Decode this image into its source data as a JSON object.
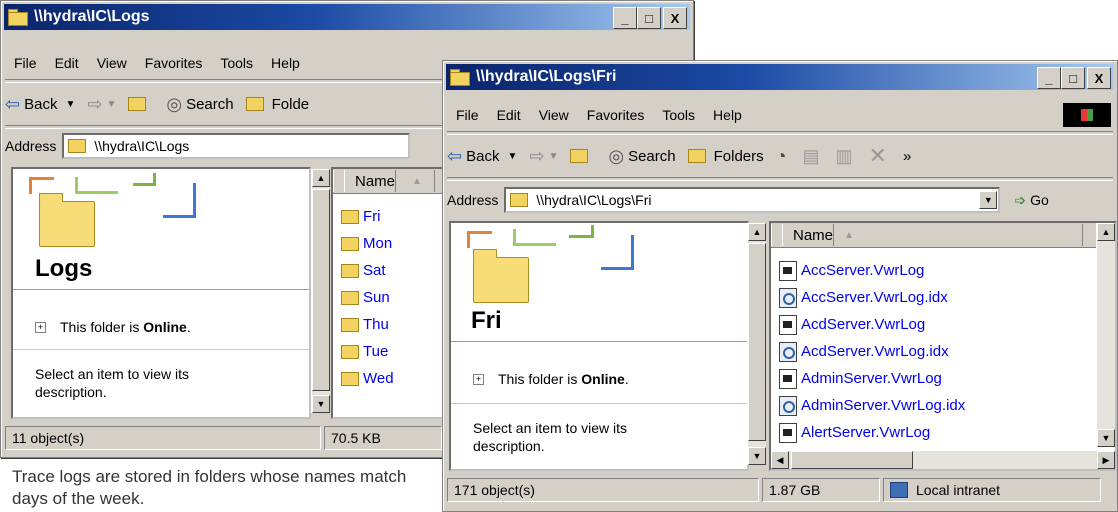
{
  "back_window": {
    "title": "\\\\hydra\\IC\\Logs",
    "title_buttons": [
      "_",
      "□",
      "X"
    ],
    "menu": [
      "File",
      "Edit",
      "View",
      "Favorites",
      "Tools",
      "Help"
    ],
    "toolbar": {
      "back": "Back",
      "search": "Search",
      "folders": "Folde"
    },
    "address_label": "Address",
    "address_value": "\\\\hydra\\IC\\Logs",
    "pane_title": "Logs",
    "online_text_prefix": "This folder is ",
    "online_text_bold": "Online",
    "online_text_suffix": ".",
    "description": "Select an item to view its description.",
    "column_name": "Name",
    "items": [
      "Fri",
      "Mon",
      "Sat",
      "Sun",
      "Thu",
      "Tue",
      "Wed"
    ],
    "status_objects": "11 object(s)",
    "status_size": "70.5 KB"
  },
  "front_window": {
    "title": "\\\\hydra\\IC\\Logs\\Fri",
    "title_buttons": [
      "_",
      "□",
      "X"
    ],
    "menu": [
      "File",
      "Edit",
      "View",
      "Favorites",
      "Tools",
      "Help"
    ],
    "toolbar": {
      "back": "Back",
      "search": "Search",
      "folders": "Folders",
      "more": "»"
    },
    "address_label": "Address",
    "address_value": "\\\\hydra\\IC\\Logs\\Fri",
    "go_label": "Go",
    "pane_title": "Fri",
    "online_text_prefix": "This folder is ",
    "online_text_bold": "Online",
    "online_text_suffix": ".",
    "description": "Select an item to view its description.",
    "column_name": "Name",
    "files": [
      {
        "name": "AccServer.VwrLog",
        "icon": "log-file-icon"
      },
      {
        "name": "AccServer.VwrLog.idx",
        "icon": "index-file-icon"
      },
      {
        "name": "AcdServer.VwrLog",
        "icon": "log-file-icon"
      },
      {
        "name": "AcdServer.VwrLog.idx",
        "icon": "index-file-icon"
      },
      {
        "name": "AdminServer.VwrLog",
        "icon": "log-file-icon"
      },
      {
        "name": "AdminServer.VwrLog.idx",
        "icon": "index-file-icon"
      },
      {
        "name": "AlertServer.VwrLog",
        "icon": "log-file-icon"
      }
    ],
    "status_objects": "171 object(s)",
    "status_size": "1.87 GB",
    "status_zone": "Local intranet"
  },
  "caption": "Trace logs are stored in folders whose names match days of the week."
}
